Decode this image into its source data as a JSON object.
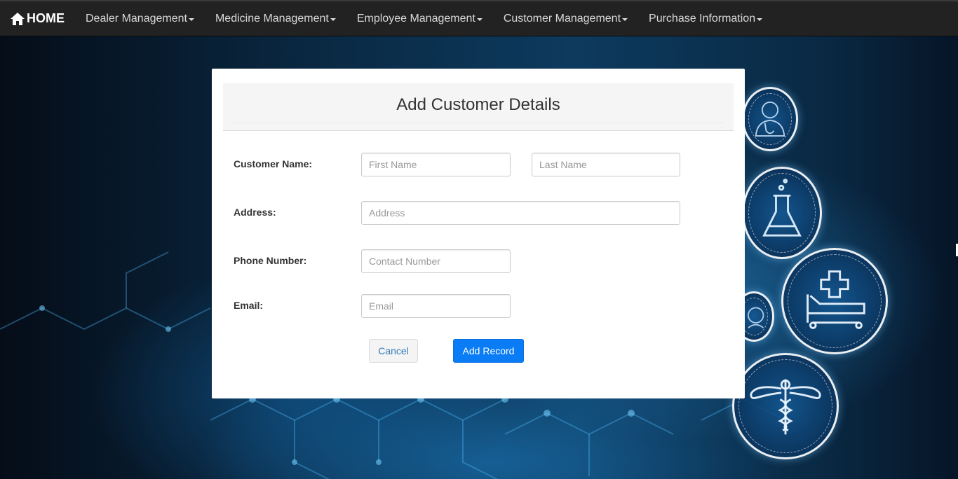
{
  "navbar": {
    "brand": "HOME",
    "items": [
      {
        "label": "Dealer Management"
      },
      {
        "label": "Medicine Management"
      },
      {
        "label": "Employee Management"
      },
      {
        "label": "Customer Management"
      },
      {
        "label": "Purchase Information"
      }
    ]
  },
  "form": {
    "title": "Add Customer Details",
    "customer_name_label": "Customer Name:",
    "first_name_placeholder": "First Name",
    "last_name_placeholder": "Last Name",
    "address_label": "Address:",
    "address_placeholder": "Address",
    "phone_label": "Phone Number:",
    "phone_placeholder": "Contact Number",
    "email_label": "Email:",
    "email_placeholder": "Email",
    "cancel_label": "Cancel",
    "add_label": "Add Record"
  },
  "decorations": {
    "icons": [
      "doctor-icon",
      "flask-icon",
      "hospital-bed-icon",
      "nurse-icon",
      "caduceus-icon"
    ]
  },
  "colors": {
    "navbar_bg": "#222222",
    "primary_button": "#0a7cf5",
    "link_text": "#337ab7"
  }
}
